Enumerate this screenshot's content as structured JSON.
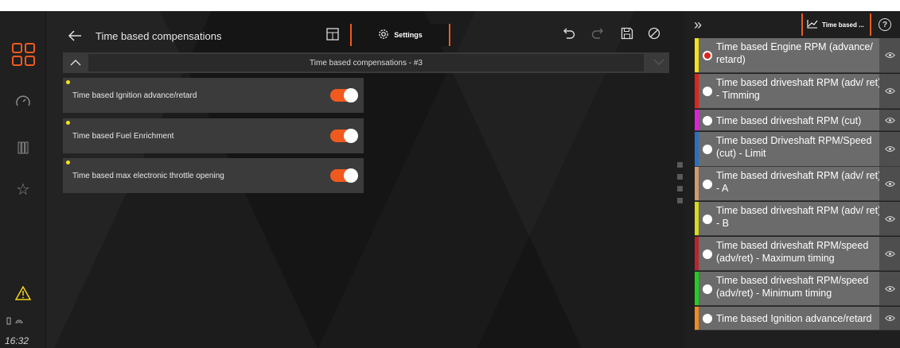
{
  "status": {
    "time": "16:32"
  },
  "header": {
    "title": "Time based compensations",
    "settings_tab": "Settings"
  },
  "section": {
    "title": "Time based compensations - #3"
  },
  "toggles": [
    {
      "label": "Time based Ignition advance/retard",
      "on": true
    },
    {
      "label": "Time based Fuel Enrichment",
      "on": true
    },
    {
      "label": "Time based max electronic throttle opening",
      "on": true
    }
  ],
  "right_panel": {
    "tab_label": "Time based ...",
    "help": "?",
    "series": [
      {
        "label": "Time based Engine RPM (advance/ retard)",
        "color": "#f2e21a",
        "selected": true
      },
      {
        "label": "Time based driveshaft RPM (adv/ ret) - Timming",
        "color": "#e3231b",
        "selected": false
      },
      {
        "label": "Time based driveshaft RPM (cut)",
        "color": "#e51be0",
        "selected": false
      },
      {
        "label": "Time based Driveshaft RPM/Speed (cut) - Limit",
        "color": "#2a6fc4",
        "selected": false
      },
      {
        "label": "Time based driveshaft RPM (adv/ ret) - A",
        "color": "#d19a6e",
        "selected": false
      },
      {
        "label": "Time based driveshaft RPM (adv/ ret) - B",
        "color": "#d8d81e",
        "selected": false
      },
      {
        "label": "Time based driveshaft RPM/speed (adv/ret) - Maximum timing",
        "color": "#b8262c",
        "selected": false
      },
      {
        "label": "Time based driveshaft RPM/speed (adv/ret) - Minimum timing",
        "color": "#1ed01e",
        "selected": false
      },
      {
        "label": "Time based Ignition advance/retard",
        "color": "#f28a1e",
        "selected": false
      }
    ]
  },
  "colors": {
    "accent": "#f05a1e",
    "indicator": "#f4e51c"
  }
}
